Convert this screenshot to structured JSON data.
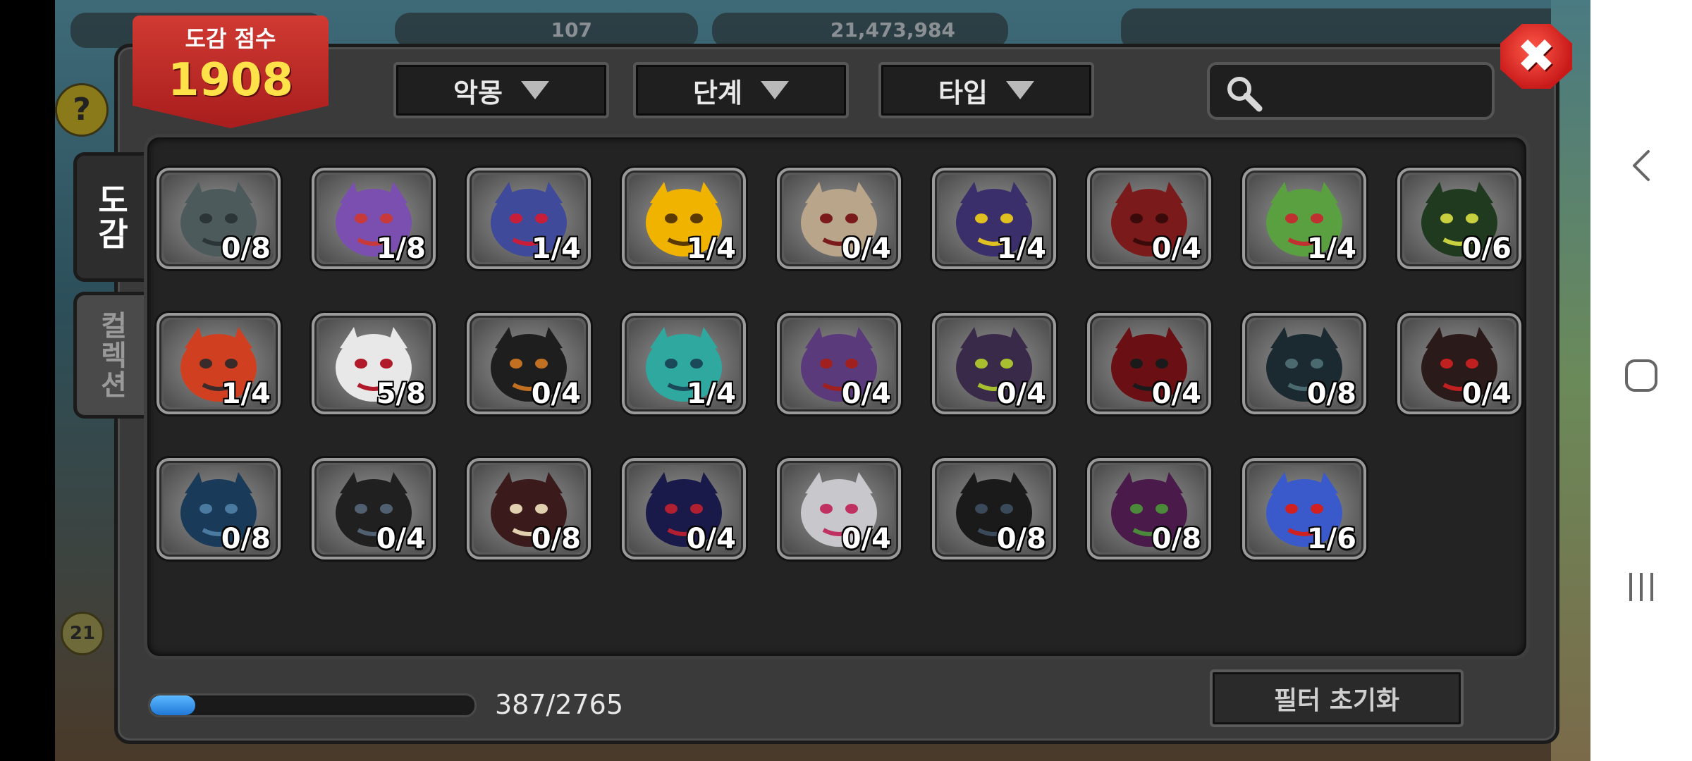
{
  "header": {
    "score_label": "도감 점수",
    "score_value": "1908"
  },
  "filters": {
    "dropdown_1": "악몽",
    "dropdown_2": "단계",
    "dropdown_3": "타입",
    "search_placeholder": ""
  },
  "tabs": [
    {
      "label": "도감",
      "active": true
    },
    {
      "label": "컬렉션",
      "active": false
    }
  ],
  "monsters": [
    {
      "count": "0/8",
      "icon": "gray-spiky-dragon-icon"
    },
    {
      "count": "1/8",
      "icon": "purple-egg-icon"
    },
    {
      "count": "1/4",
      "icon": "horned-blue-demon-icon"
    },
    {
      "count": "1/4",
      "icon": "golden-egg-icon"
    },
    {
      "count": "0/4",
      "icon": "pale-mask-creature-icon"
    },
    {
      "count": "1/4",
      "icon": "purple-horned-blob-icon"
    },
    {
      "count": "0/4",
      "icon": "red-dragon-icon"
    },
    {
      "count": "1/4",
      "icon": "cactus-icon"
    },
    {
      "count": "0/6",
      "icon": "green-shadow-beast-icon"
    },
    {
      "count": "1/4",
      "icon": "red-striped-egg-icon"
    },
    {
      "count": "5/8",
      "icon": "white-crimson-dragon-icon"
    },
    {
      "count": "0/4",
      "icon": "black-dragon-icon"
    },
    {
      "count": "1/4",
      "icon": "teal-crystal-egg-icon"
    },
    {
      "count": "0/4",
      "icon": "horned-warrior-icon"
    },
    {
      "count": "0/4",
      "icon": "hooded-purple-creature-icon"
    },
    {
      "count": "0/4",
      "icon": "dark-red-dragon-icon"
    },
    {
      "count": "0/8",
      "icon": "hooded-shadow-icon"
    },
    {
      "count": "0/4",
      "icon": "black-gold-dragon-icon"
    },
    {
      "count": "0/8",
      "icon": "dark-blue-dragon-icon"
    },
    {
      "count": "0/4",
      "icon": "shadow-dragon-icon"
    },
    {
      "count": "0/8",
      "icon": "fanged-beast-icon"
    },
    {
      "count": "0/4",
      "icon": "navy-dragon-icon"
    },
    {
      "count": "0/4",
      "icon": "white-ghost-dragon-icon"
    },
    {
      "count": "0/8",
      "icon": "black-wolf-dragon-icon"
    },
    {
      "count": "0/8",
      "icon": "purple-armored-beast-icon"
    },
    {
      "count": "1/6",
      "icon": "blue-flame-crystal-icon"
    }
  ],
  "progress": {
    "text": "387/2765",
    "fraction": 0.14
  },
  "buttons": {
    "reset_filter": "필터 초기화",
    "close": "✖"
  },
  "background_hud": {
    "value_1": "107",
    "value_2": "21,473,984",
    "help": "?",
    "level": "21"
  }
}
